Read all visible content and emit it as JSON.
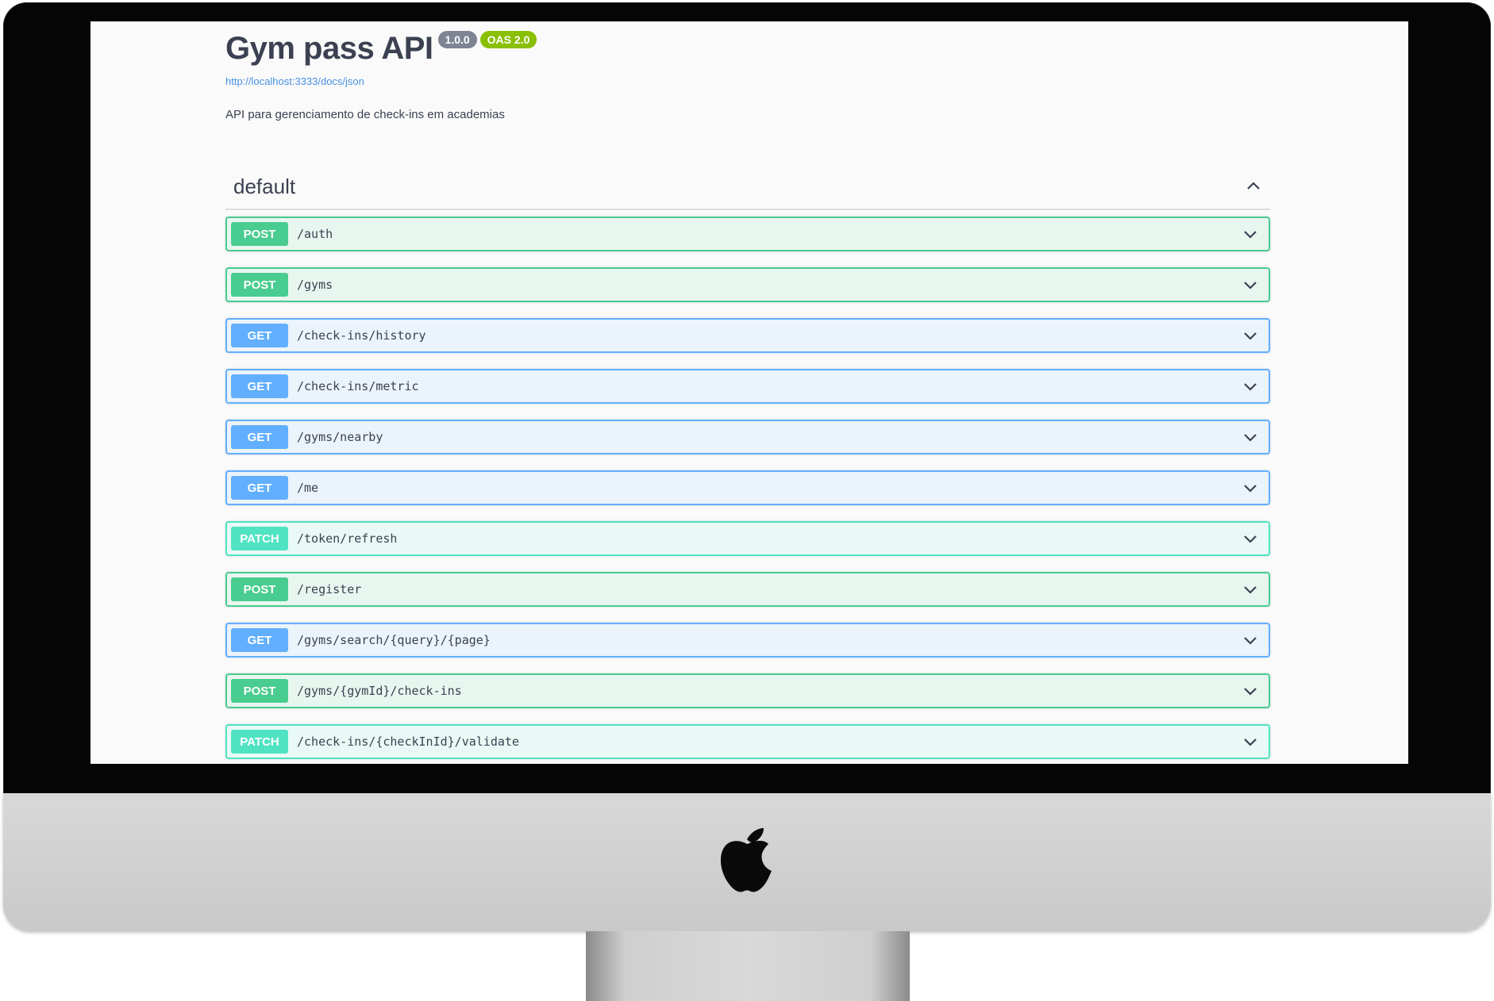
{
  "info": {
    "title": "Gym pass API",
    "version": "1.0.0",
    "oas": "OAS 2.0",
    "spec_url": "http://localhost:3333/docs/json",
    "description": "API para gerenciamento de check-ins em academias"
  },
  "section": {
    "title": "default",
    "expanded": true
  },
  "operations": [
    {
      "method": "POST",
      "path": "/auth"
    },
    {
      "method": "POST",
      "path": "/gyms"
    },
    {
      "method": "GET",
      "path": "/check-ins/history"
    },
    {
      "method": "GET",
      "path": "/check-ins/metric"
    },
    {
      "method": "GET",
      "path": "/gyms/nearby"
    },
    {
      "method": "GET",
      "path": "/me"
    },
    {
      "method": "PATCH",
      "path": "/token/refresh"
    },
    {
      "method": "POST",
      "path": "/register"
    },
    {
      "method": "GET",
      "path": "/gyms/search/{query}/{page}"
    },
    {
      "method": "POST",
      "path": "/gyms/{gymId}/check-ins"
    },
    {
      "method": "PATCH",
      "path": "/check-ins/{checkInId}/validate"
    }
  ],
  "colors": {
    "post": "#49cc90",
    "get": "#61affe",
    "patch": "#50e3c2",
    "text": "#3b4151",
    "link": "#4990e2"
  },
  "icons": {
    "section_toggle": "chevron-up-icon",
    "operation_toggle": "chevron-down-icon",
    "device_logo": "apple-logo-icon"
  }
}
